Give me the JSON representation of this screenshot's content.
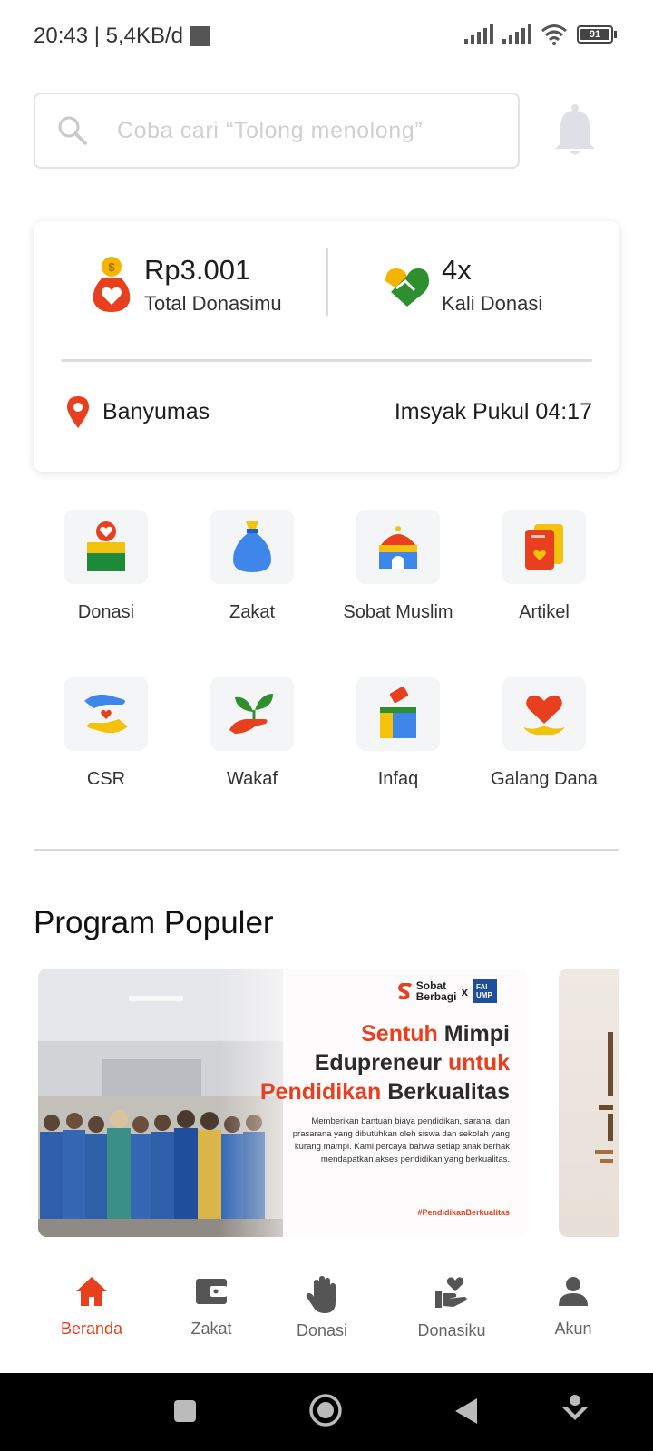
{
  "status_bar": {
    "time_speed": "20:43 | 5,4KB/d",
    "battery": "91"
  },
  "search": {
    "placeholder": "Coba cari “Tolong menolong”"
  },
  "summary": {
    "total_value": "Rp3.001",
    "total_label": "Total Donasimu",
    "count_value": "4x",
    "count_label": "Kali Donasi",
    "location": "Banyumas",
    "imsyak": "Imsyak Pukul 04:17"
  },
  "menu": {
    "items": [
      {
        "label": "Donasi",
        "icon": "donation-box-icon"
      },
      {
        "label": "Zakat",
        "icon": "money-bag-icon"
      },
      {
        "label": "Sobat Muslim",
        "icon": "mosque-icon"
      },
      {
        "label": "Artikel",
        "icon": "article-icon"
      },
      {
        "label": "CSR",
        "icon": "csr-hands-icon"
      },
      {
        "label": "Wakaf",
        "icon": "plant-hand-icon"
      },
      {
        "label": "Infaq",
        "icon": "infaq-box-icon"
      },
      {
        "label": "Galang Dana",
        "icon": "heart-hand-icon"
      }
    ]
  },
  "section": {
    "title": "Program Populer"
  },
  "banner": {
    "brand": "Sobat Berbagi",
    "brand_x": "x",
    "partner": "FAI UMP",
    "headline_line1_red": "Sentuh",
    "headline_line1": "Mimpi",
    "headline_line2": "Edupreneur",
    "headline_line2_red": "untuk",
    "headline_line3_red": "Pendidikan",
    "headline_line3": "Berkualitas",
    "description": "Memberikan bantuan biaya pendidikan, sarana, dan prasarana yang dibutuhkan oleh siswa dan sekolah yang kurang mampi. Kami percaya bahwa setiap anak berhak mendapatkan akses pendidikan yang berkualitas.",
    "hashtag": "#PendidikanBerkualitas"
  },
  "bottom_nav": {
    "items": [
      {
        "label": "Beranda",
        "icon": "home-icon",
        "active": true
      },
      {
        "label": "Zakat",
        "icon": "wallet-icon",
        "active": false
      },
      {
        "label": "Donasi",
        "icon": "hand-icon",
        "active": false
      },
      {
        "label": "Donasiku",
        "icon": "heart-hand-icon",
        "active": false
      },
      {
        "label": "Akun",
        "icon": "user-icon",
        "active": false
      }
    ]
  },
  "colors": {
    "accent": "#e8401e",
    "text": "#1e1e1e",
    "tile_bg": "#f4f5f7"
  }
}
